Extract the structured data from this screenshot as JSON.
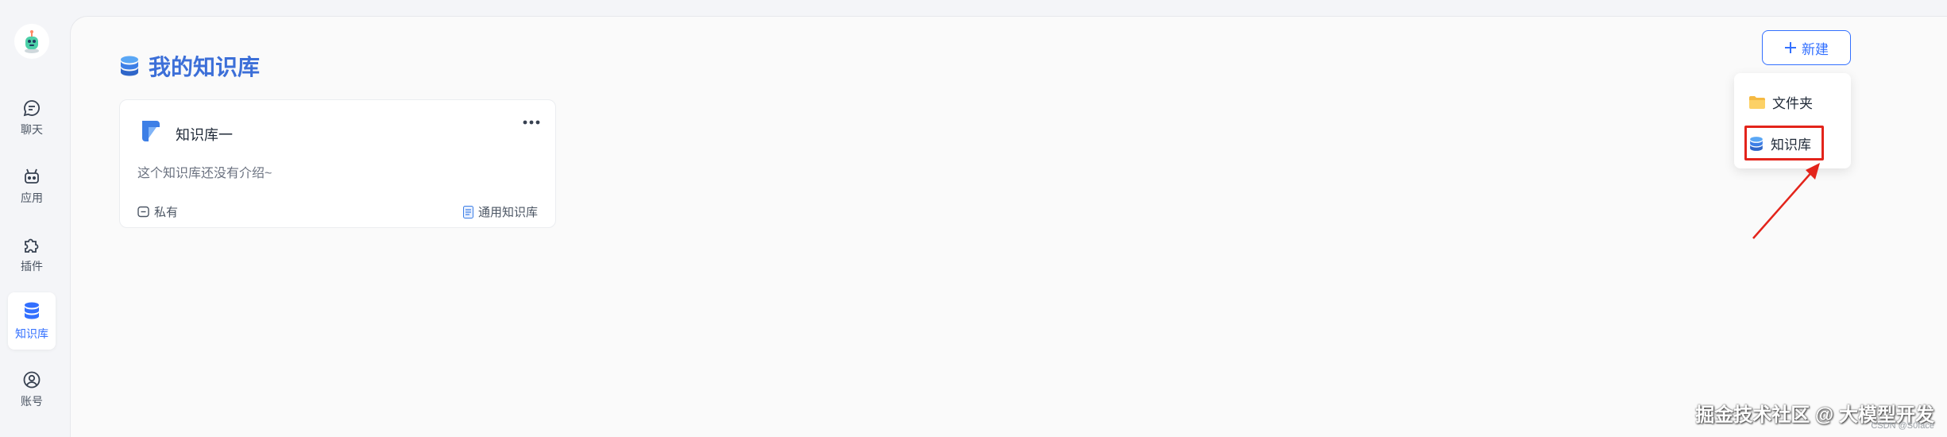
{
  "sidebar": {
    "logo_icon": "robot-avatar-icon",
    "items": [
      {
        "label": "聊天",
        "icon": "chat-bubble-icon",
        "active": false
      },
      {
        "label": "应用",
        "icon": "robot-icon",
        "active": false
      },
      {
        "label": "插件",
        "icon": "puzzle-icon",
        "active": false
      },
      {
        "label": "知识库",
        "icon": "database-icon",
        "active": true
      },
      {
        "label": "账号",
        "icon": "user-circle-icon",
        "active": false
      }
    ]
  },
  "header": {
    "title": "我的知识库",
    "title_icon": "knowledge-base-icon"
  },
  "toolbar": {
    "new_label": "新建",
    "new_icon": "plus-icon"
  },
  "dropdown": {
    "items": [
      {
        "label": "文件夹",
        "icon": "folder-icon"
      },
      {
        "label": "知识库",
        "icon": "knowledge-base-icon"
      }
    ]
  },
  "cards": [
    {
      "name": "知识库一",
      "description": "这个知识库还没有介绍~",
      "visibility": "私有",
      "type": "通用知识库",
      "icon": "knowledge-base-logo-icon"
    }
  ],
  "watermark": {
    "main": "掘金技术社区 @ 大模型开发",
    "sub": "CSDN @S0face"
  },
  "colors": {
    "accent": "#3370ff",
    "title": "#3c6fd8",
    "annotation": "#e3241b"
  }
}
